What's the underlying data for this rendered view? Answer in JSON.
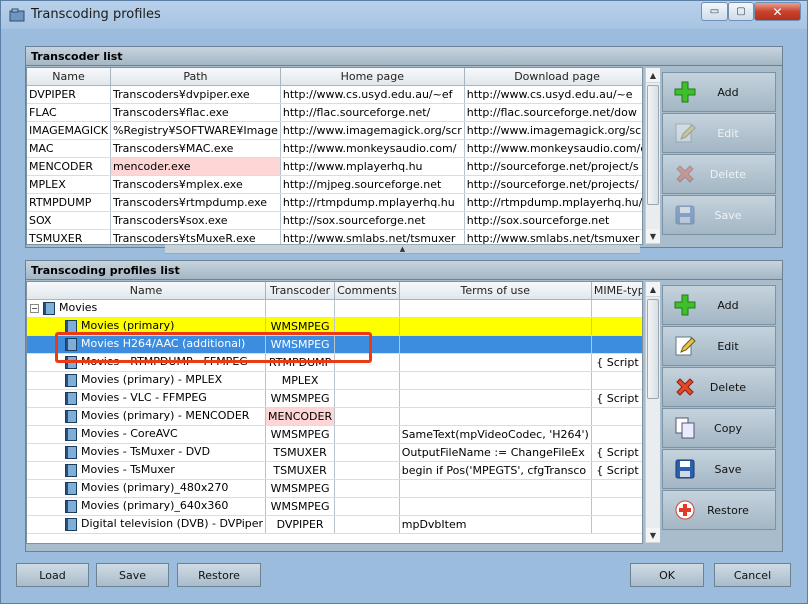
{
  "window": {
    "title": "Transcoding profiles",
    "controls": {
      "minimize": "▭",
      "maximize": "▢",
      "close": "✕"
    }
  },
  "transcoder_list": {
    "title": "Transcoder list",
    "columns": [
      "Name",
      "Path",
      "Home page",
      "Download page"
    ],
    "rows": [
      [
        "DVPIPER",
        "Transcoders¥dvpiper.exe",
        "http://www.cs.usyd.edu.au/~ef",
        "http://www.cs.usyd.edu.au/~e"
      ],
      [
        "FLAC",
        "Transcoders¥flac.exe",
        "http://flac.sourceforge.net/",
        "http://flac.sourceforge.net/dow"
      ],
      [
        "IMAGEMAGICK",
        "%Registry¥SOFTWARE¥Image",
        "http://www.imagemagick.org/scr",
        "http://www.imagemagick.org/scr"
      ],
      [
        "MAC",
        "Transcoders¥MAC.exe",
        "http://www.monkeysaudio.com/",
        "http://www.monkeysaudio.com/d"
      ],
      [
        "MENCODER",
        "mencoder.exe",
        "http://www.mplayerhq.hu",
        "http://sourceforge.net/project/s"
      ],
      [
        "MPLEX",
        "Transcoders¥mplex.exe",
        "http://mjpeg.sourceforge.net",
        "http://sourceforge.net/projects/"
      ],
      [
        "RTMPDUMP",
        "Transcoders¥rtmpdump.exe",
        "http://rtmpdump.mplayerhq.hu",
        "http://rtmpdump.mplayerhq.hu/"
      ],
      [
        "SOX",
        "Transcoders¥sox.exe",
        "http://sox.sourceforge.net",
        "http://sox.sourceforge.net"
      ],
      [
        "TSMUXER",
        "Transcoders¥tsMuxeR.exe",
        "http://www.smlabs.net/tsmuxer",
        "http://www.smlabs.net/tsmuxer"
      ]
    ],
    "buttons": [
      "Add",
      "Edit",
      "Delete",
      "Save"
    ]
  },
  "profiles_list": {
    "title": "Transcoding profiles list",
    "columns": [
      "Name",
      "Transcoder",
      "Comments",
      "Terms of use",
      "MIME-type"
    ],
    "root": "Movies",
    "rows": [
      [
        "Movies (primary)",
        "WMSMPEG",
        "",
        "",
        ""
      ],
      [
        "Movies H264/AAC (additional)",
        "WMSMPEG",
        "",
        "",
        ""
      ],
      [
        "Movies - RTMPDUMP - FFMPEG",
        "RTMPDUMP",
        "",
        "",
        "{ Script }"
      ],
      [
        "Movies (primary) - MPLEX",
        "MPLEX",
        "",
        "",
        ""
      ],
      [
        "Movies - VLC - FFMPEG",
        "WMSMPEG",
        "",
        "",
        "{ Script }"
      ],
      [
        "Movies (primary) - MENCODER",
        "MENCODER",
        "",
        "",
        ""
      ],
      [
        "Movies - CoreAVC",
        "WMSMPEG",
        "",
        "SameText(mpVideoCodec, 'H264')",
        ""
      ],
      [
        "Movies - TsMuxer - DVD",
        "TSMUXER",
        "",
        "OutputFileName := ChangeFileEx",
        "{ Script }"
      ],
      [
        "Movies - TsMuxer",
        "TSMUXER",
        "",
        "begin if Pos('MPEGTS', cfgTransco",
        "{ Script }"
      ],
      [
        "Movies (primary)_480x270",
        "WMSMPEG",
        "",
        "",
        ""
      ],
      [
        "Movies (primary)_640x360",
        "WMSMPEG",
        "",
        "",
        ""
      ],
      [
        "Digital television (DVB) - DVPiper",
        "DVPIPER",
        "",
        "mpDvbItem",
        ""
      ]
    ],
    "buttons": [
      "Add",
      "Edit",
      "Delete",
      "Copy",
      "Save",
      "Restore"
    ]
  },
  "footer": {
    "load": "Load",
    "save": "Save",
    "restore": "Restore",
    "ok": "OK",
    "cancel": "Cancel"
  },
  "colors": {
    "highlight_yellow": "#ffff00",
    "selection_blue": "#3c8de0",
    "invalid_pink": "#ffd6d6",
    "callout_red": "#ee3a12"
  }
}
